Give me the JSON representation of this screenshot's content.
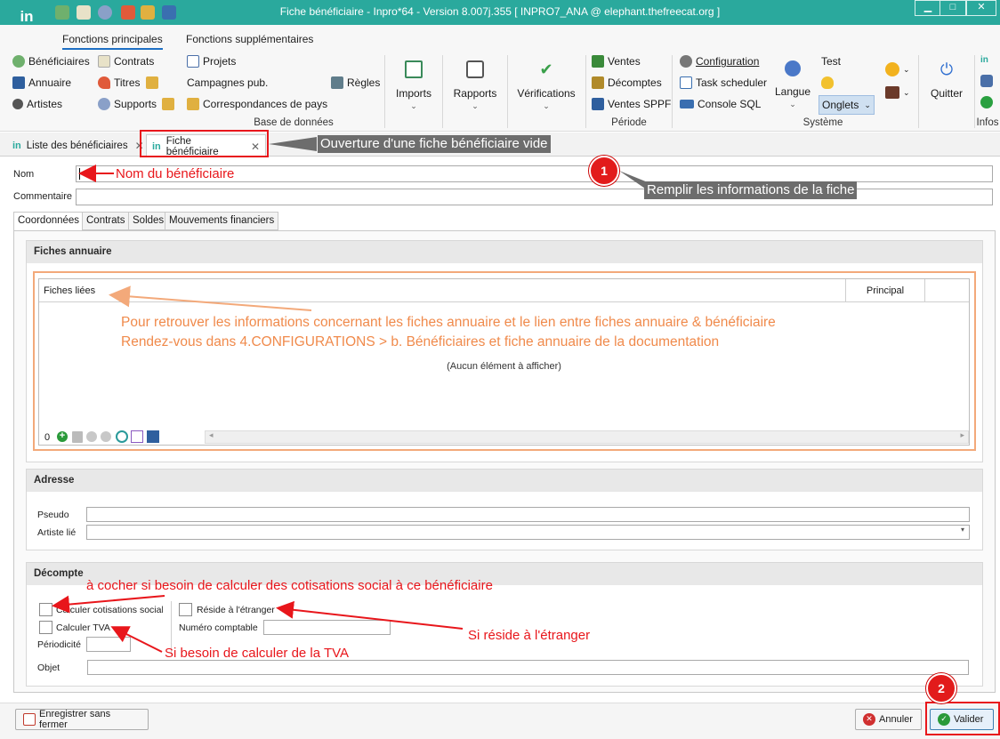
{
  "window": {
    "title": "Fiche bénéficiaire - Inpro*64 - Version 8.007j.355  [ INPRO7_ANA @ elephant.thefreecat.org ]",
    "app_logo": "in"
  },
  "ribbon": {
    "tabs": [
      "Fonctions principales",
      "Fonctions supplémentaires"
    ],
    "base_items": {
      "beneficiaires": "Bénéficiaires",
      "annuaire": "Annuaire",
      "artistes": "Artistes",
      "contrats": "Contrats",
      "titres": "Titres",
      "supports": "Supports",
      "projets": "Projets",
      "campagnes": "Campagnes pub.",
      "correspondances": "Correspondances de pays",
      "regles": "Règles"
    },
    "base_group_label": "Base de données",
    "imports": "Imports",
    "rapports": "Rapports",
    "verifications": "Vérifications",
    "periode": {
      "ventes": "Ventes",
      "decomptes": "Décomptes",
      "ventes_sppf": "Ventes SPPF",
      "label": "Période"
    },
    "systeme": {
      "configuration": "Configuration",
      "task_scheduler": "Task scheduler",
      "console_sql": "Console SQL",
      "langue": "Langue",
      "test": "Test",
      "onglets": "Onglets",
      "quitter": "Quitter",
      "label": "Système"
    },
    "infos_label": "Infos"
  },
  "doc_tabs": [
    {
      "label": "Liste des bénéficiaires"
    },
    {
      "label": "Fiche bénéficiaire"
    }
  ],
  "form": {
    "nom_label": "Nom",
    "commentaire_label": "Commentaire",
    "subtabs": [
      "Coordonnées",
      "Contrats",
      "Soldes",
      "Mouvements financiers"
    ],
    "fiches_annuaire": {
      "title": "Fiches annuaire",
      "col_fiches": "Fiches liées",
      "col_principal": "Principal",
      "empty": "(Aucun élément à afficher)",
      "count": "0"
    },
    "adresse": {
      "title": "Adresse",
      "pseudo": "Pseudo",
      "artiste_lie": "Artiste lié"
    },
    "decompte": {
      "title": "Décompte",
      "calc_cotisations": "Calculer cotisations social",
      "calc_tva": "Calculer TVA",
      "periodicite": "Périodicité",
      "reside_etranger": "Réside à l'étranger",
      "numero_comptable": "Numéro comptable",
      "objet": "Objet"
    }
  },
  "footer": {
    "save_no_close": "Enregistrer sans fermer",
    "annuler": "Annuler",
    "valider": "Valider"
  },
  "annotations": {
    "ouverture": "Ouverture d'une fiche bénéficiaire vide",
    "nom_beneficiaire": "Nom du bénéficiaire",
    "remplir": "Remplir les informations de la fiche",
    "step1": "1",
    "step2": "2",
    "orange_line1": "Pour retrouver les informations concernant les fiches annuaire et le lien entre fiches annuaire & bénéficiaire",
    "orange_line2": "Rendez-vous dans 4.CONFIGURATIONS > b. Bénéficiaires et fiche annuaire de la documentation",
    "cocher": "à cocher si besoin de calculer des cotisations social à ce bénéficiaire",
    "tva": "Si besoin de calculer de la TVA",
    "reside": "Si réside à l'étranger"
  },
  "colors": {
    "teal": "#2aa99d",
    "annotation_red": "#e8161b",
    "annotation_orange": "#f08a4b",
    "annotation_gray": "#6d6d6d"
  }
}
